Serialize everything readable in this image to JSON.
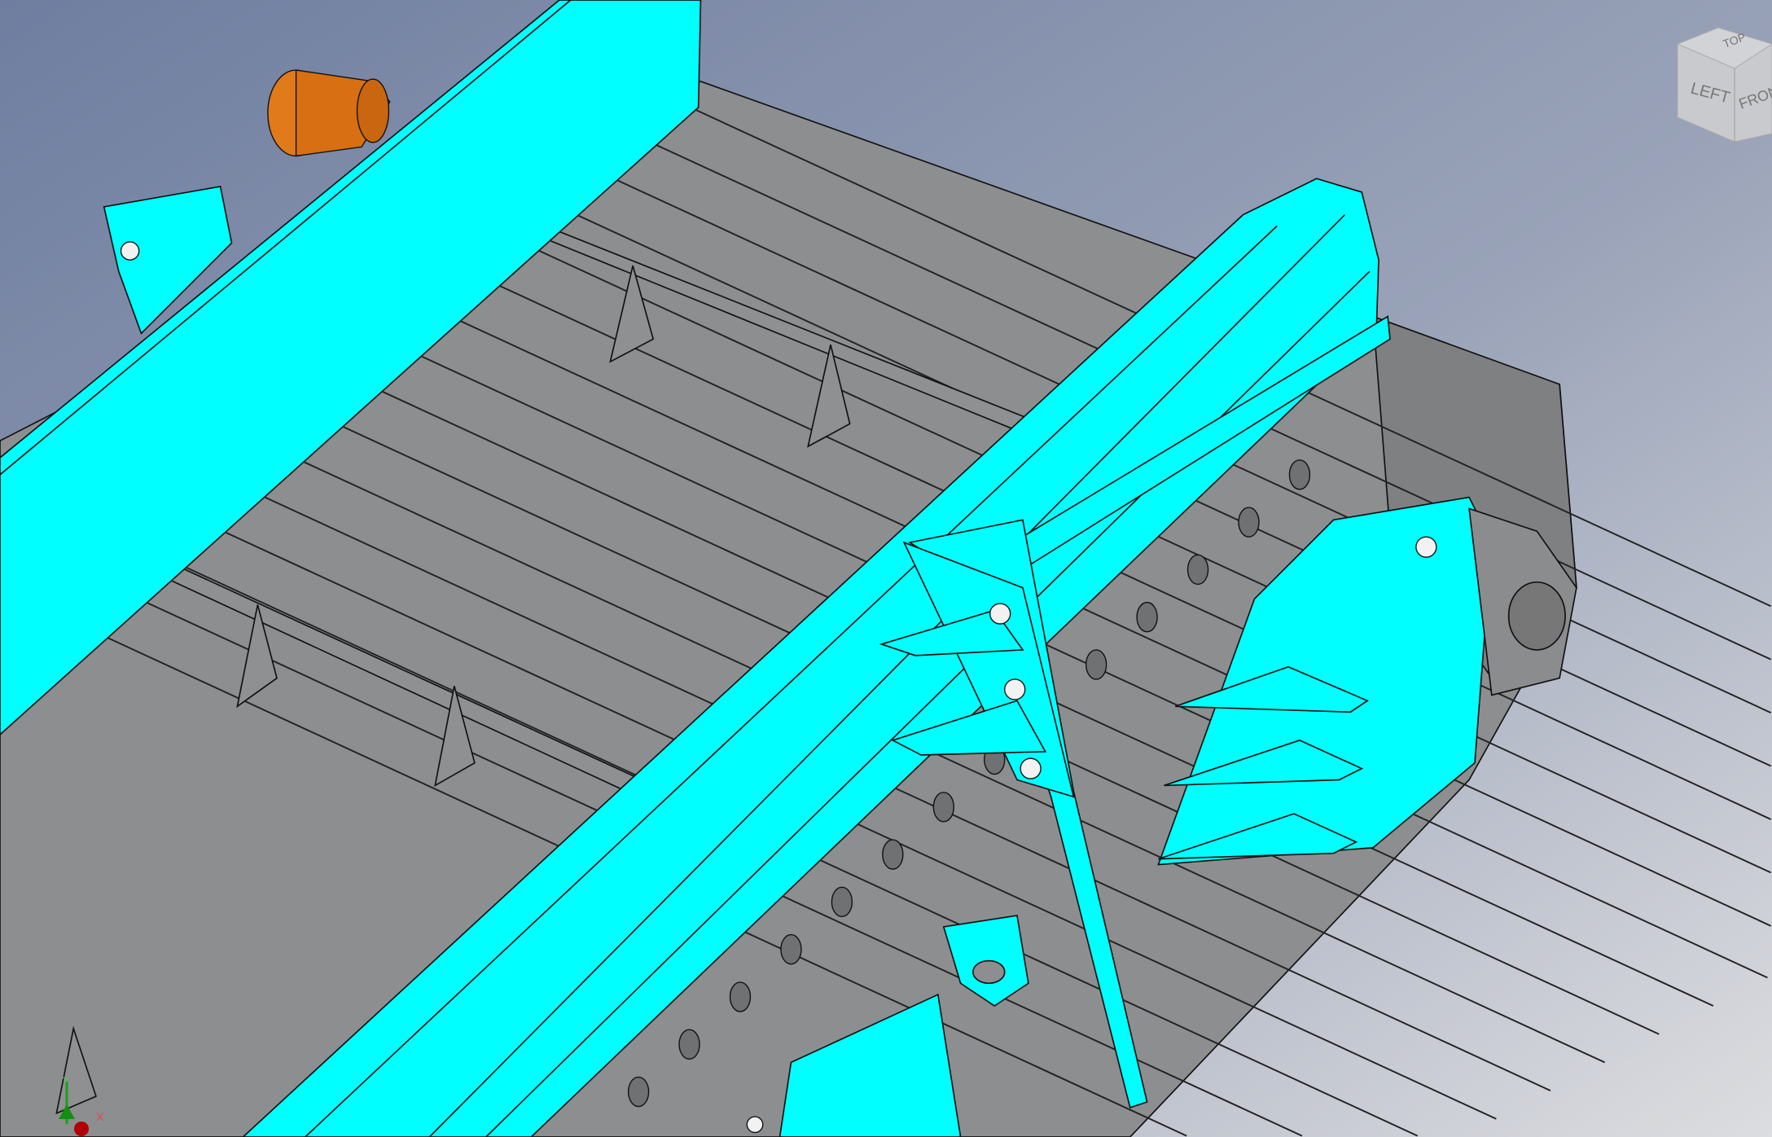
{
  "viewport": {
    "colors": {
      "frame": "#00ffff",
      "bed": "#8c8e90",
      "motor": "#e07a1a",
      "background_top": "#7886a6",
      "background_bottom": "#d2d4d8"
    }
  },
  "viewcube": {
    "faces": {
      "top": "TOP",
      "left": "LEFT",
      "front": "FRONT"
    }
  },
  "triad": {
    "x_label": "X",
    "y_label": "Y"
  }
}
